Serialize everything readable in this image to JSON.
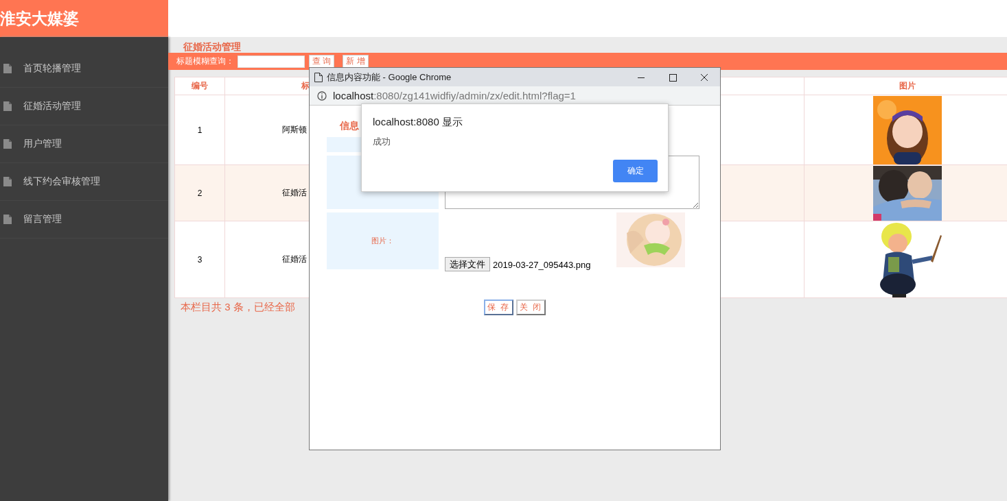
{
  "app": {
    "title": "淮安大媒婆"
  },
  "sidebar": {
    "items": [
      {
        "label": "首页轮播管理"
      },
      {
        "label": "征婚活动管理"
      },
      {
        "label": "用户管理"
      },
      {
        "label": "线下约会审核管理"
      },
      {
        "label": "留言管理"
      }
    ]
  },
  "page": {
    "heading": "征婚活动管理"
  },
  "search": {
    "label": "标题模糊查询：",
    "buttons": [
      "查 询",
      "新 增"
    ]
  },
  "table": {
    "columns": [
      {
        "kind": "text",
        "label": "编号"
      },
      {
        "kind": "text",
        "label": "标"
      },
      {
        "kind": "covered"
      },
      {
        "kind": "text",
        "label": "图片"
      }
    ],
    "rows": [
      {
        "number": "1",
        "title": "阿斯顿",
        "highlighted": false
      },
      {
        "number": "2",
        "title": "征婚活",
        "highlighted": true
      },
      {
        "number": "3",
        "title": "征婚活",
        "highlighted": false
      }
    ]
  },
  "footer": "本栏目共 3 条，已经全部",
  "dialog": {
    "title": "信息内容功能 - Google Chrome",
    "url_host": "localhost",
    "url_rest": ":8080/zg141widfiy/admin/zx/edit.html?flag=1",
    "form": {
      "heading": "信息",
      "image_label": "图片：",
      "file_button": "选择文件",
      "file_name": "2019-03-27_095443.png",
      "buttons": [
        "保 存",
        "关 闭"
      ]
    }
  },
  "alert": {
    "title": "localhost:8080 显示",
    "message": "成功",
    "button": "确定"
  }
}
